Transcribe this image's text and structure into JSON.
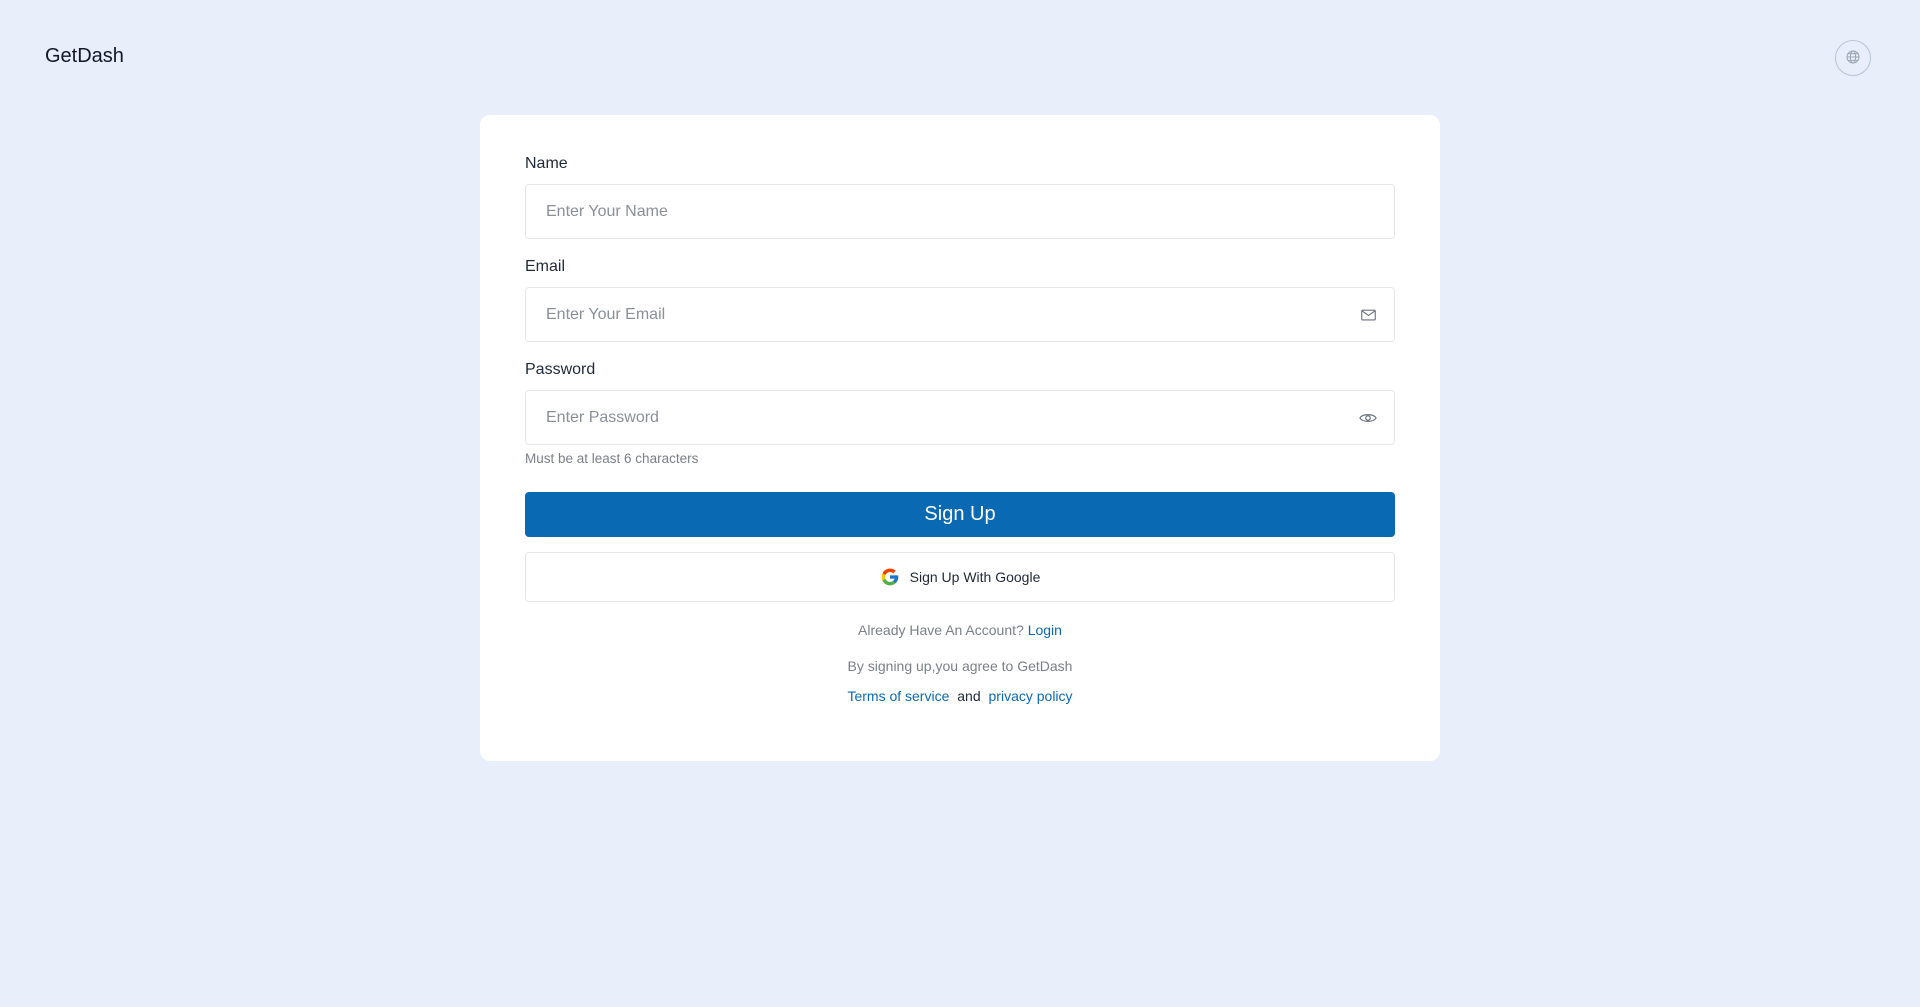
{
  "header": {
    "brand": "GetDash",
    "language_icon": "globe-icon"
  },
  "form": {
    "name": {
      "label": "Name",
      "placeholder": "Enter Your Name",
      "value": ""
    },
    "email": {
      "label": "Email",
      "placeholder": "Enter Your Email",
      "value": "",
      "icon": "mail-icon"
    },
    "password": {
      "label": "Password",
      "placeholder": "Enter Password",
      "value": "",
      "icon": "eye-icon",
      "hint": "Must be at least 6 characters"
    },
    "submit_label": "Sign Up",
    "google_label": "Sign Up With Google",
    "google_icon": "google-icon"
  },
  "footer": {
    "account_prompt": "Already Have An Account?",
    "login_label": "Login",
    "agreement": "By signing up,you agree to GetDash",
    "terms_label": "Terms of service",
    "and_text": "and",
    "privacy_label": "privacy policy"
  },
  "colors": {
    "background": "#e8effb",
    "primary": "#0a69b3",
    "card": "#ffffff"
  }
}
